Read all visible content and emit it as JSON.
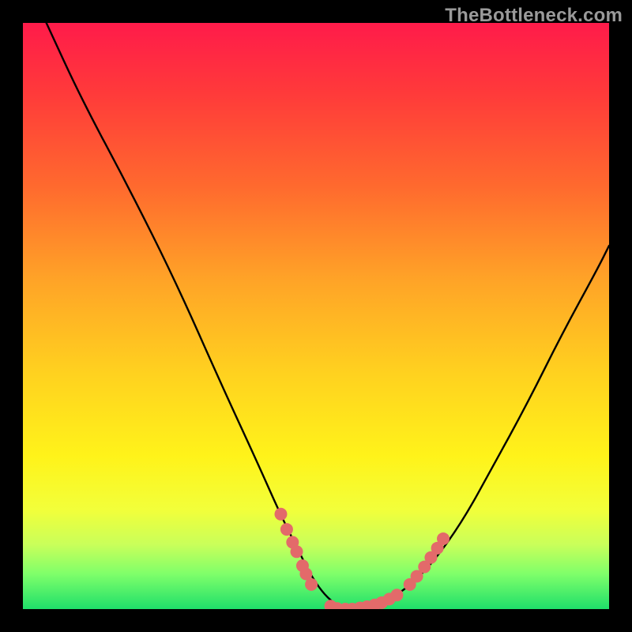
{
  "watermark": "TheBottleneck.com",
  "chart_data": {
    "type": "line",
    "title": "",
    "xlabel": "",
    "ylabel": "",
    "xlim": [
      0,
      100
    ],
    "ylim": [
      0,
      100
    ],
    "series": [
      {
        "name": "curve",
        "color": "#000000",
        "x": [
          4,
          10,
          18,
          26,
          34,
          40,
          44,
          47,
          49,
          51,
          53,
          55,
          57,
          59,
          61,
          63,
          66,
          70,
          75,
          80,
          86,
          92,
          98,
          100
        ],
        "y": [
          100,
          87,
          72,
          56,
          38,
          25,
          16,
          10,
          6,
          3,
          1,
          0,
          0,
          0,
          1,
          2,
          4,
          8,
          15,
          24,
          35,
          47,
          58,
          62
        ]
      },
      {
        "name": "dots-left",
        "color": "#e36a6a",
        "type": "scatter",
        "x": [
          44,
          45,
          46,
          46.7,
          47.7,
          48.3,
          49.2
        ],
        "y": [
          16.2,
          13.6,
          11.4,
          9.8,
          7.4,
          6.0,
          4.2
        ]
      },
      {
        "name": "dots-bottom",
        "color": "#e36a6a",
        "type": "scatter",
        "x": [
          52.5,
          53.6,
          55,
          56.2,
          57.5,
          58.7,
          60,
          61.2,
          62.5,
          63.8
        ],
        "y": [
          0.5,
          0.1,
          0,
          0,
          0.2,
          0.4,
          0.7,
          1.1,
          1.7,
          2.4
        ]
      },
      {
        "name": "dots-right",
        "color": "#e36a6a",
        "type": "scatter",
        "x": [
          66,
          67.2,
          68.5,
          69.6,
          70.7,
          71.7
        ],
        "y": [
          4.2,
          5.6,
          7.2,
          8.8,
          10.4,
          12.0
        ]
      }
    ],
    "grid": false,
    "legend": false
  }
}
